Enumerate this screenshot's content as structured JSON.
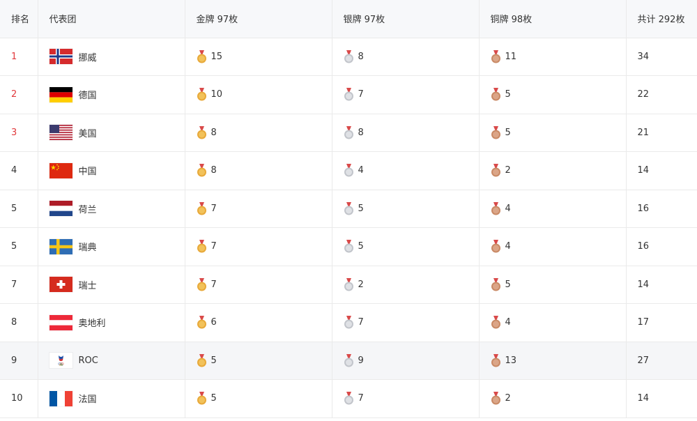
{
  "headers": {
    "rank": "排名",
    "team": "代表团",
    "gold": "金牌 97枚",
    "silver": "银牌 97枚",
    "bronze": "铜牌 98枚",
    "total": "共计 292枚"
  },
  "colors": {
    "top_rank": "#e1393c",
    "gold": "#e8a93a",
    "silver": "#c9cbd0",
    "bronze": "#c98a66",
    "ribbon": "#d94a4a"
  },
  "rows": [
    {
      "rank": "1",
      "country": "挪威",
      "flag": "norway-flag-icon",
      "gold": "15",
      "silver": "8",
      "bronze": "11",
      "total": "34"
    },
    {
      "rank": "2",
      "country": "德国",
      "flag": "germany-flag-icon",
      "gold": "10",
      "silver": "7",
      "bronze": "5",
      "total": "22"
    },
    {
      "rank": "3",
      "country": "美国",
      "flag": "usa-flag-icon",
      "gold": "8",
      "silver": "8",
      "bronze": "5",
      "total": "21"
    },
    {
      "rank": "4",
      "country": "中国",
      "flag": "china-flag-icon",
      "gold": "8",
      "silver": "4",
      "bronze": "2",
      "total": "14"
    },
    {
      "rank": "5",
      "country": "荷兰",
      "flag": "netherlands-flag-icon",
      "gold": "7",
      "silver": "5",
      "bronze": "4",
      "total": "16"
    },
    {
      "rank": "5",
      "country": "瑞典",
      "flag": "sweden-flag-icon",
      "gold": "7",
      "silver": "5",
      "bronze": "4",
      "total": "16"
    },
    {
      "rank": "7",
      "country": "瑞士",
      "flag": "switzerland-flag-icon",
      "gold": "7",
      "silver": "2",
      "bronze": "5",
      "total": "14"
    },
    {
      "rank": "8",
      "country": "奥地利",
      "flag": "austria-flag-icon",
      "gold": "6",
      "silver": "7",
      "bronze": "4",
      "total": "17"
    },
    {
      "rank": "9",
      "country": "ROC",
      "flag": "roc-flag-icon",
      "gold": "5",
      "silver": "9",
      "bronze": "13",
      "total": "27"
    },
    {
      "rank": "10",
      "country": "法国",
      "flag": "france-flag-icon",
      "gold": "5",
      "silver": "7",
      "bronze": "2",
      "total": "14"
    }
  ]
}
